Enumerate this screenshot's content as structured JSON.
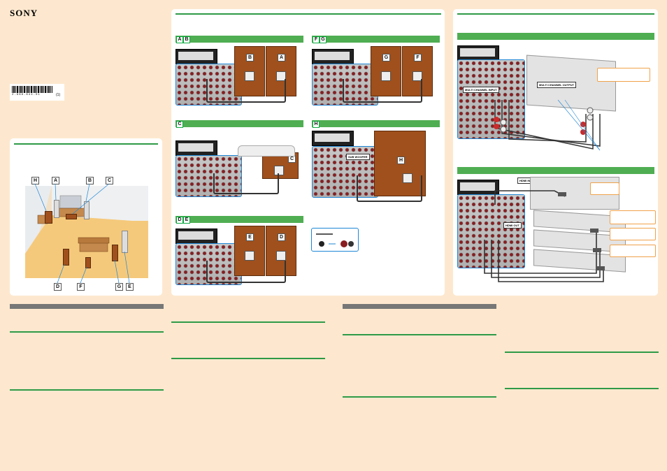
{
  "brand": {
    "logo_text": "SONY"
  },
  "barcode": {
    "digits": "2-688-844-01",
    "suffix": "(1)"
  },
  "speaker_labels": [
    "H",
    "A",
    "B",
    "C",
    "D",
    "F",
    "G",
    "E"
  ],
  "sections": {
    "ab": {
      "tags": [
        "A",
        "B"
      ]
    },
    "fg": {
      "tags": [
        "F",
        "G"
      ]
    },
    "c": {
      "tags": [
        "C"
      ]
    },
    "h": {
      "tags": [
        "H"
      ]
    },
    "de": {
      "tags": [
        "D",
        "E"
      ]
    }
  },
  "callouts": {
    "subwoofer": "SUB WOOFER",
    "multi_channel_input": "MULTI CHANNEL INPUT",
    "multi_channel_output": "MULTI CHANNEL OUTPUT",
    "hdmi_input": "HDMI INPUT",
    "hdmi_out": "HDMI OUT"
  },
  "colors": {
    "background": "#fde8cf",
    "green_rule": "#2e9a47",
    "green_bar": "#4fae52",
    "cable_highlight": "#1d86d6",
    "speaker_wood": "#a0501c"
  }
}
